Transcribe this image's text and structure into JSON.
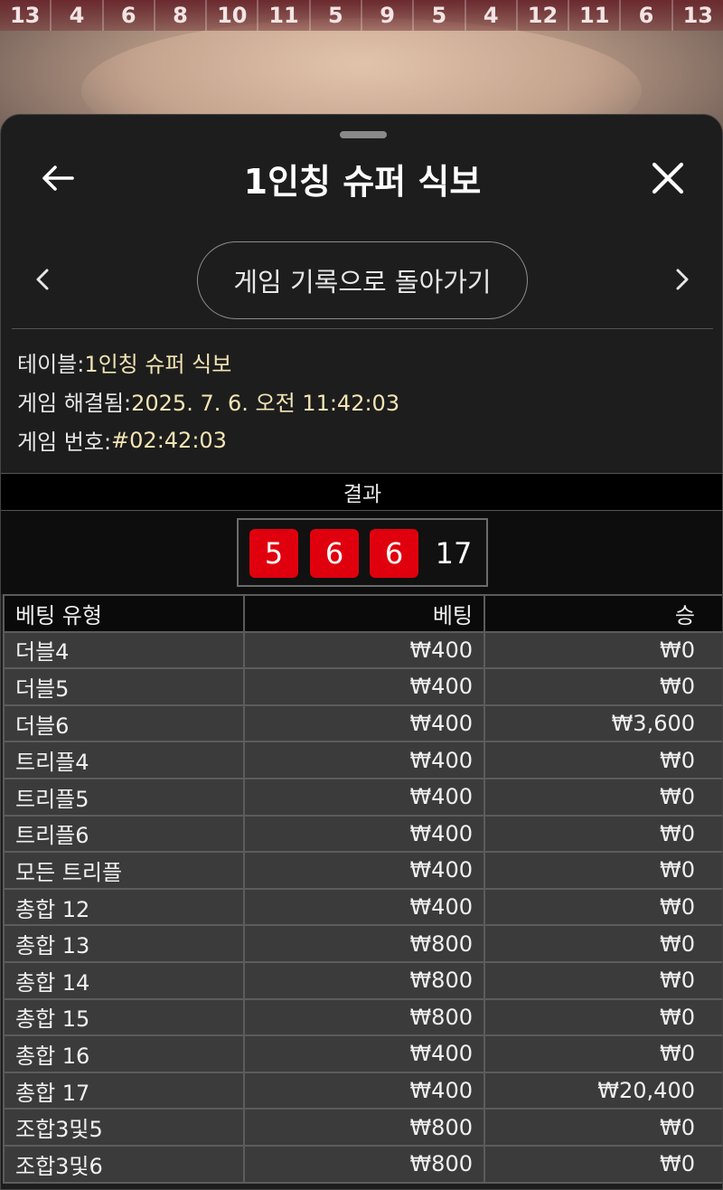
{
  "history_numbers": [
    "13",
    "4",
    "6",
    "8",
    "10",
    "11",
    "5",
    "9",
    "5",
    "4",
    "12",
    "11",
    "6",
    "13"
  ],
  "panel": {
    "title": "1인칭 슈퍼 식보",
    "return_label": "게임 기록으로 돌아가기"
  },
  "info": {
    "table_label": "테이블:",
    "table_value": "1인칭 슈퍼 식보",
    "resolved_label": "게임 해결됨:",
    "resolved_value": "2025. 7. 6. 오전 11:42:03",
    "game_no_label": "게임 번호:",
    "game_no_value": "#02:42:03"
  },
  "result": {
    "header": "결과",
    "dice": [
      "5",
      "6",
      "6"
    ],
    "total": "17"
  },
  "table": {
    "headers": [
      "베팅 유형",
      "베팅",
      "승"
    ],
    "rows": [
      [
        "더블4",
        "₩400",
        "₩0"
      ],
      [
        "더블5",
        "₩400",
        "₩0"
      ],
      [
        "더블6",
        "₩400",
        "₩3,600"
      ],
      [
        "트리플4",
        "₩400",
        "₩0"
      ],
      [
        "트리플5",
        "₩400",
        "₩0"
      ],
      [
        "트리플6",
        "₩400",
        "₩0"
      ],
      [
        "모든 트리플",
        "₩400",
        "₩0"
      ],
      [
        "총합 12",
        "₩400",
        "₩0"
      ],
      [
        "총합 13",
        "₩800",
        "₩0"
      ],
      [
        "총합 14",
        "₩800",
        "₩0"
      ],
      [
        "총합 15",
        "₩800",
        "₩0"
      ],
      [
        "총합 16",
        "₩400",
        "₩0"
      ],
      [
        "총합 17",
        "₩400",
        "₩20,400"
      ],
      [
        "조합3및5",
        "₩800",
        "₩0"
      ],
      [
        "조합3및6",
        "₩800",
        "₩0"
      ]
    ]
  },
  "colors": {
    "die_red": "#e0000d",
    "info_value": "#f3e4b4",
    "panel_bg": "#1d1d1d"
  },
  "icons": [
    "back-arrow-icon",
    "close-icon",
    "chevron-left-icon",
    "chevron-right-icon"
  ]
}
